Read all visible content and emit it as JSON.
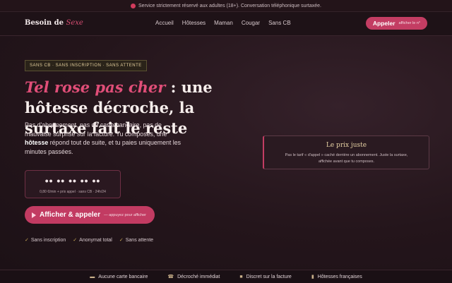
{
  "topbar": {
    "notice": "Service strictement réservé aux adultes (18+). Conversation téléphonique surtaxée."
  },
  "header": {
    "logo_main": "Besoin de",
    "logo_accent": "Sexe",
    "nav": [
      "Accueil",
      "Hôtesses",
      "Maman",
      "Cougar",
      "Sans CB"
    ],
    "call_label": "Appeler",
    "call_sub": "afficher le n°"
  },
  "hero": {
    "pill": "SANS CB · SANS INSCRIPTION · SANS ATTENTE",
    "title_accent": "Tel rose pas cher",
    "title_rest": " : une hôtesse décroche, la surtaxe fait le reste",
    "lead_1": "Pas d'abonnement, pas de carte bancaire, pas de mauvaise surprise sur la facture. Tu composes, une ",
    "lead_bold": "hôtesse",
    "lead_2": " répond tout de suite, et tu paies uniquement les minutes passées.",
    "number": "•• •• •• •• ••",
    "number_sub": "0,80 €/min + prix appel · sans CB · 24h/24",
    "cta_label": "Afficher & appeler",
    "cta_sub": "— appuyez pour afficher",
    "checks": [
      "Sans inscription",
      "Anonymat total",
      "Sans attente"
    ]
  },
  "card": {
    "title": "Le prix juste",
    "text": "Pas le tarif « d'appel » caché derrière un abonnement. Juste la surtaxe, affichée avant que tu composes."
  },
  "footer": {
    "items": [
      {
        "icon": "card-icon",
        "label": "Aucune carte bancaire"
      },
      {
        "icon": "phone-icon",
        "label": "Décroché immédiat"
      },
      {
        "icon": "lock-icon",
        "label": "Discret sur la facture"
      },
      {
        "icon": "flag-icon",
        "label": "Hôtesses françaises"
      }
    ]
  },
  "colors": {
    "accent": "#c33d63",
    "gold": "#e7d2a4",
    "bg": "#1c1116"
  }
}
